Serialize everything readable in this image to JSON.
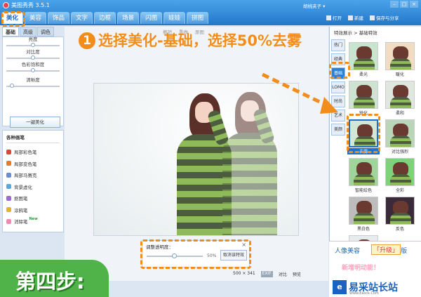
{
  "app": {
    "title": "美图秀秀 3.5.1",
    "user": "胡桃夹子 ▾",
    "window_buttons": [
      "–",
      "□",
      "×"
    ]
  },
  "tabs": [
    {
      "label": "美化",
      "active": true
    },
    {
      "label": "美容",
      "active": false
    },
    {
      "label": "饰品",
      "active": false
    },
    {
      "label": "文字",
      "active": false
    },
    {
      "label": "边框",
      "active": false
    },
    {
      "label": "场景",
      "active": false
    },
    {
      "label": "闪图",
      "active": false
    },
    {
      "label": "娃娃",
      "active": false
    },
    {
      "label": "拼图",
      "active": false
    }
  ],
  "actions": {
    "open": "打开",
    "new": "新建",
    "save": "保存与分享"
  },
  "left_panel": {
    "subtabs": [
      "基础",
      "高级",
      "调色"
    ],
    "adjust": {
      "items": [
        {
          "label": "亮度",
          "value": 0.5
        },
        {
          "label": "对比度",
          "value": 0.5
        },
        {
          "label": "色彩饱和度",
          "value": 0.5
        },
        {
          "label": "清晰度",
          "value": 0.1
        }
      ],
      "one_key": "一键美化"
    },
    "brushes": {
      "title": "各种画笔",
      "items": [
        {
          "label": "局部彩色笔",
          "color": "#d9483b"
        },
        {
          "label": "局部变色笔",
          "color": "#e67b2a"
        },
        {
          "label": "局部马赛克",
          "color": "#6a8fd0"
        },
        {
          "label": "背景虚化",
          "color": "#58a9d8"
        },
        {
          "label": "抠图笔",
          "color": "#9b6bd4"
        },
        {
          "label": "涂鸦笔",
          "color": "#e2b13a"
        },
        {
          "label": "消除笔",
          "color": "#f08ab0",
          "tag": "New"
        }
      ]
    }
  },
  "canvas": {
    "toolbar": [
      "撤销",
      "重做",
      "原图"
    ],
    "fade_box": {
      "label": "调整透明度：",
      "value_text": "50%",
      "value": 0.5,
      "button": "取消该特效",
      "close": "×"
    },
    "status": {
      "size": "500 × 341",
      "chip": "EXIF",
      "compare": "对比",
      "preview": "预览"
    }
  },
  "right_panel": {
    "title": "特效展示 > 基础特效",
    "categories": [
      {
        "label": "热门",
        "active": false
      },
      {
        "label": "经典",
        "active": false
      },
      {
        "label": "基础",
        "active": true
      },
      {
        "label": "LOMO",
        "active": false
      },
      {
        "label": "时尚",
        "active": false
      },
      {
        "label": "艺术",
        "active": false
      },
      {
        "label": "美颜",
        "active": false
      }
    ],
    "effects": [
      {
        "label": "柔光",
        "tint": "#c8e5d0"
      },
      {
        "label": "暖化",
        "tint": "#f2dcc2"
      },
      {
        "label": "锐化",
        "tint": "#cfe3d2"
      },
      {
        "label": "柔和",
        "tint": "#dfe7df"
      },
      {
        "label": "去雾",
        "tint": "#d4e7d6",
        "selected": true
      },
      {
        "label": "对比强烈",
        "tint": "#b9d6b9"
      },
      {
        "label": "智能绘色",
        "tint": "#9fd49a"
      },
      {
        "label": "全彩",
        "tint": "#7ed27a"
      },
      {
        "label": "黑白色",
        "tint": "#bdbdbd"
      },
      {
        "label": "反色",
        "tint": "#3a2a3a"
      },
      {
        "label": "",
        "tint": "#e6ecee"
      }
    ]
  },
  "ad": {
    "t1": "人像美容",
    "t2": "「升级」",
    "t3": "版",
    "t4": "新增明动能！"
  },
  "watermark": {
    "logo": "e",
    "text": "易采站长站",
    "sub": "Www.Easck.Com"
  },
  "annotation": {
    "number": "1",
    "text": "选择美化-基础，选择50%去雾"
  },
  "step_banner": "第四步:",
  "colors": {
    "accent": "#f28c1b",
    "blue": "#2377c8",
    "green": "#4fb34a"
  }
}
